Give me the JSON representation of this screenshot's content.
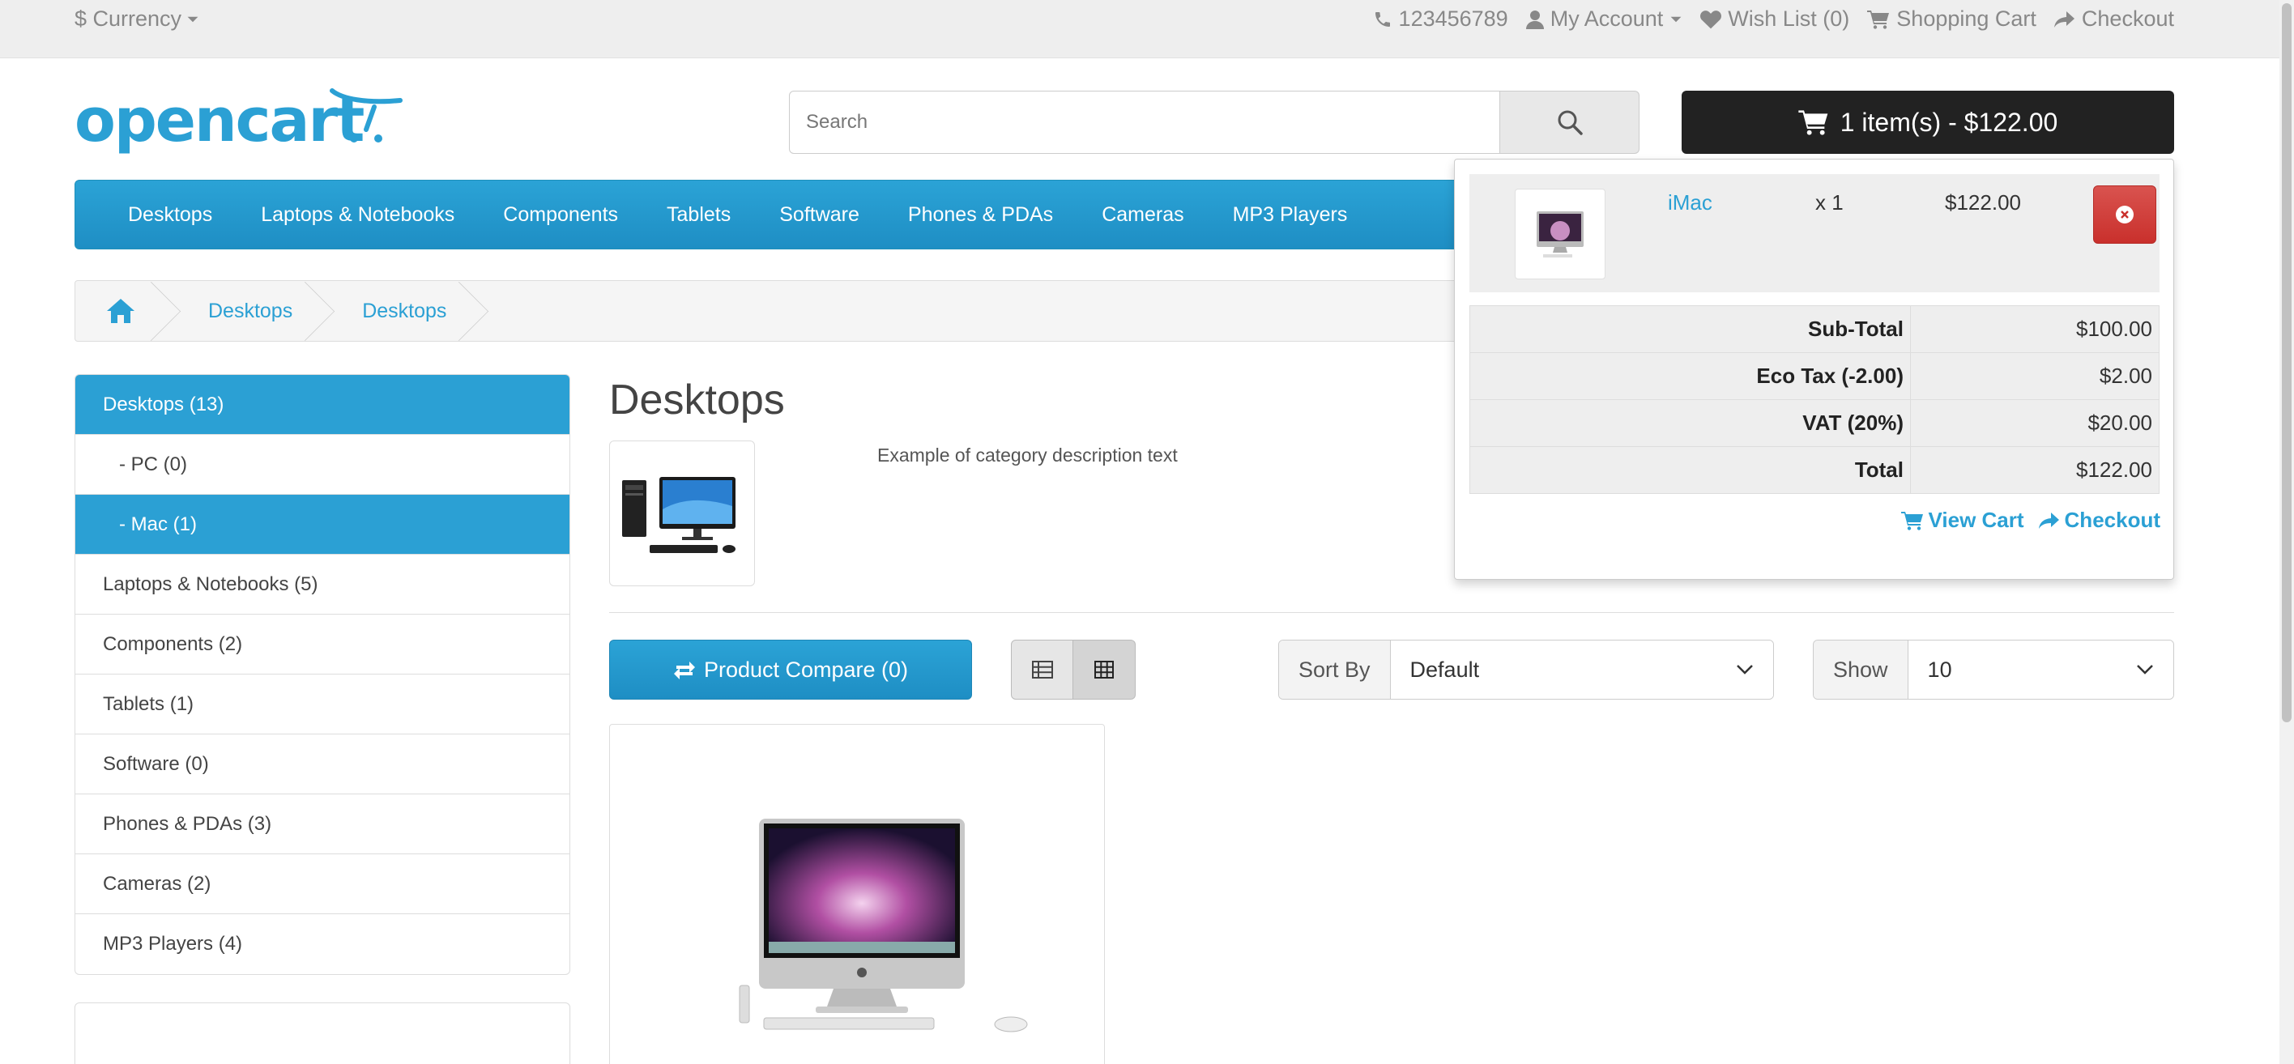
{
  "topbar": {
    "currency": "$ Currency",
    "phone": "123456789",
    "my_account": "My Account",
    "wishlist": "Wish List (0)",
    "shopping_cart": "Shopping Cart",
    "checkout": "Checkout"
  },
  "logo_text": "opencart",
  "search": {
    "placeholder": "Search"
  },
  "cart_button": "1 item(s) - $122.00",
  "menu": [
    "Desktops",
    "Laptops & Notebooks",
    "Components",
    "Tablets",
    "Software",
    "Phones & PDAs",
    "Cameras",
    "MP3 Players"
  ],
  "breadcrumb": [
    "Desktops",
    "Desktops"
  ],
  "sidebar": [
    {
      "label": "Desktops (13)",
      "active": true,
      "sub": false
    },
    {
      "label": "- PC (0)",
      "active": false,
      "sub": true
    },
    {
      "label": "- Mac (1)",
      "active": true,
      "sub": true
    },
    {
      "label": "Laptops & Notebooks (5)",
      "active": false,
      "sub": false
    },
    {
      "label": "Components (2)",
      "active": false,
      "sub": false
    },
    {
      "label": "Tablets (1)",
      "active": false,
      "sub": false
    },
    {
      "label": "Software (0)",
      "active": false,
      "sub": false
    },
    {
      "label": "Phones & PDAs (3)",
      "active": false,
      "sub": false
    },
    {
      "label": "Cameras (2)",
      "active": false,
      "sub": false
    },
    {
      "label": "MP3 Players (4)",
      "active": false,
      "sub": false
    }
  ],
  "content": {
    "title": "Desktops",
    "description": "Example of category description text",
    "compare_button": "Product Compare (0)",
    "sort_label": "Sort By",
    "sort_value": "Default",
    "show_label": "Show",
    "show_value": "10"
  },
  "cart_dropdown": {
    "item": {
      "name": "iMac",
      "qty": "x 1",
      "price": "$122.00"
    },
    "totals": [
      {
        "label": "Sub-Total",
        "value": "$100.00"
      },
      {
        "label": "Eco Tax (-2.00)",
        "value": "$2.00"
      },
      {
        "label": "VAT (20%)",
        "value": "$20.00"
      },
      {
        "label": "Total",
        "value": "$122.00"
      }
    ],
    "view_cart": "View Cart",
    "checkout": "Checkout"
  },
  "colors": {
    "accent": "#2ba0d4",
    "dark": "#222222",
    "danger": "#d9534f"
  }
}
